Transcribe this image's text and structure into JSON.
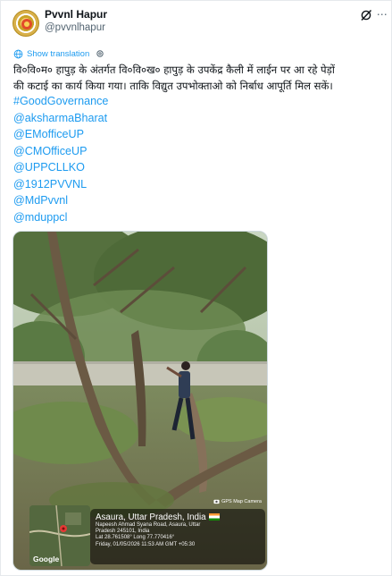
{
  "author": {
    "display_name": "Pvvnl Hapur",
    "handle": "@pvvnlhapur"
  },
  "translate": {
    "label": "Show translation"
  },
  "tweet": {
    "line1": "वि०वि०म० हापुड़ के अंतर्गत वि०वि०ख० हापुड़ के उपकेंद्र कैली में लाईन पर आ रहे पेड़ों",
    "line2": "की कटाई का कार्य किया गया। ताकि विद्युत उपभोक्ताओ को निर्बाध आपूर्ति मिल सकें।",
    "tags": [
      "#GoodGovernance",
      "@aksharmaBharat",
      "@EMofficeUP",
      "@CMOfficeUP",
      "@UPPCLLKO",
      "@1912PVVNL",
      "@MdPvvnl",
      "@mduppcl"
    ]
  },
  "photo": {
    "gps_app": "GPS Map Camera",
    "location_title": "Asaura, Uttar Pradesh, India",
    "address_line1": "Napeesh Ahmad Syana Road, Asaura, Uttar",
    "address_line2": "Pradesh 245101, India",
    "coords": "Lat 28.761508° Long 77.770416°",
    "datetime": "Friday, 01/05/2026 11:53 AM GMT +05:30",
    "map_label": "Google"
  },
  "colors": {
    "link": "#1d9bf0",
    "text": "#0f1419",
    "muted": "#536471"
  },
  "icons": {
    "avatar": "pvvnl-logo",
    "grok": "grok-icon",
    "more": "more-icon",
    "translate": "globe-icon",
    "settings": "gear-icon"
  }
}
